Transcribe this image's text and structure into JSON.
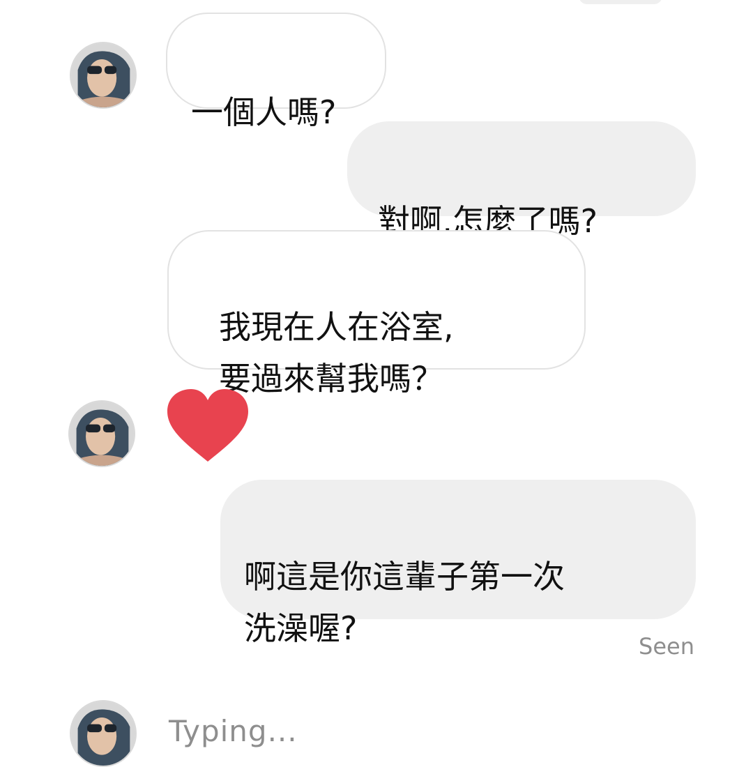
{
  "conversation": {
    "messages": [
      {
        "sender": "them",
        "text": "一個人嗎?"
      },
      {
        "sender": "me",
        "text": "對啊,怎麼了嗎?"
      },
      {
        "sender": "them",
        "text": "我現在人在浴室,\n要過來幫我嗎？"
      },
      {
        "sender": "them",
        "type": "reaction",
        "icon": "heart-icon",
        "color": "#e8434f"
      },
      {
        "sender": "me",
        "text": "啊這是你這輩子第一次\n洗澡喔?"
      }
    ],
    "seen_label": "Seen",
    "typing_label": "Typing..."
  },
  "colors": {
    "incoming_bubble": "#ffffff",
    "outgoing_bubble": "#efefef",
    "meta_text": "#8e8e8e",
    "heart": "#e8434f"
  }
}
